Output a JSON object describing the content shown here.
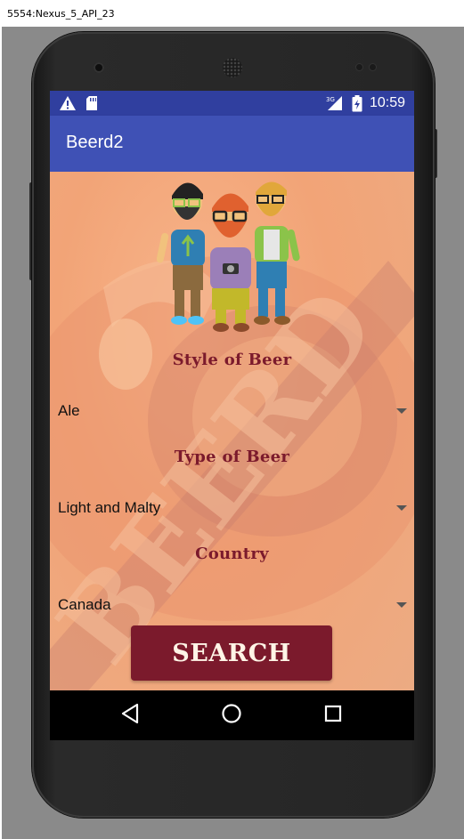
{
  "window": {
    "title": "5554:Nexus_5_API_23"
  },
  "status_bar": {
    "time": "10:59",
    "network_label": "3G"
  },
  "app_bar": {
    "title": "Beerd2"
  },
  "background": {
    "logo_text": "BEERD"
  },
  "form": {
    "style_label": "Style of Beer",
    "style_value": "Ale",
    "type_label": "Type of Beer",
    "type_value": "Light and Malty",
    "country_label": "Country",
    "country_value": "Canada",
    "search_label": "SEARCH"
  },
  "colors": {
    "status_bar": "#303f9f",
    "app_bar": "#3f51b5",
    "accent_text": "#7b1a2c",
    "button": "#7b1a2c",
    "background": "#f2a477"
  },
  "icons": {
    "status_left": [
      "warning-icon",
      "sd-card-icon"
    ],
    "status_right": [
      "signal-icon",
      "battery-icon"
    ],
    "navigation": [
      "back-icon",
      "home-icon",
      "recents-icon"
    ]
  }
}
